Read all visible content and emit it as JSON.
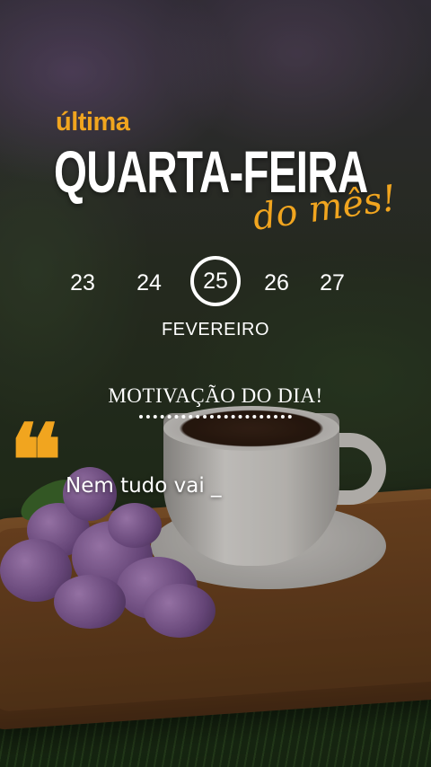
{
  "header": {
    "eyebrow": "última",
    "title": "QUARTA-FEIRA",
    "script": "do mês!"
  },
  "calendar": {
    "days": [
      "23",
      "24",
      "25",
      "26",
      "27"
    ],
    "selected_day": "25",
    "month": "FEVEREIRO"
  },
  "motivation": {
    "heading": "MOTIVAÇÃO DO DIA!",
    "quote_mark": "❝",
    "text": "Nem tudo vai _"
  },
  "colors": {
    "accent": "#f1a51f",
    "text": "#ffffff"
  }
}
